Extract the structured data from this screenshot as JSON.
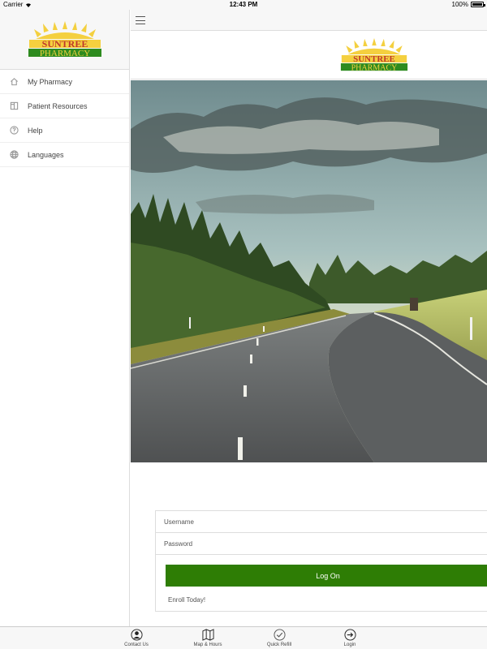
{
  "status_bar": {
    "carrier": "Carrier",
    "time": "12:43 PM",
    "battery": "100%"
  },
  "brand": {
    "name_top": "SUNTREE",
    "name_bottom": "PHARMACY"
  },
  "sidebar": {
    "items": [
      {
        "label": "My Pharmacy",
        "icon": "home-icon"
      },
      {
        "label": "Patient Resources",
        "icon": "book-icon"
      },
      {
        "label": "Help",
        "icon": "help-icon"
      },
      {
        "label": "Languages",
        "icon": "globe-icon"
      }
    ]
  },
  "login": {
    "username_placeholder": "Username",
    "password_placeholder": "Password",
    "logon_label": "Log On",
    "enroll_label": "Enroll Today!"
  },
  "tabbar": {
    "tabs": [
      {
        "label": "Contact Us",
        "icon": "contact-icon"
      },
      {
        "label": "Map & Hours",
        "icon": "map-icon"
      },
      {
        "label": "Quick Refill",
        "icon": "checkmark-icon"
      },
      {
        "label": "Login",
        "icon": "login-icon"
      }
    ]
  },
  "colors": {
    "accent_green": "#2e7d05",
    "logo_red": "#c0392b",
    "logo_yellow": "#f4d03f"
  }
}
